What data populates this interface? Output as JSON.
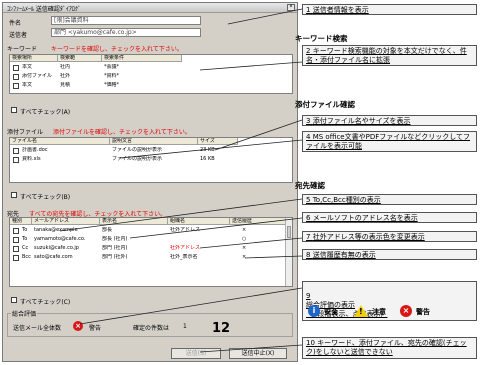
{
  "dialog": {
    "title": "ｺﾝﾌｧｰﾑﾒｰﾙ 送信確認ﾀﾞｲｱﾛｸﾞ",
    "close_label": "×",
    "sender_name_label": "件名",
    "sender_name_value": "[限]会議資料",
    "sender_addr_label": "送信者",
    "sender_addr_value": "部門 <yakumo@cafe.co.jp>",
    "keyword_label": "キーワード",
    "keyword_hint": "キーワードを確認し、チェックを入れて下さい。",
    "keyword_columns": [
      "検索場所",
      "検索範",
      "検索条件"
    ],
    "keyword_rows": [
      {
        "place": "本文",
        "range": "社内",
        "cond": "*会議*"
      },
      {
        "place": "添付ファイル",
        "range": "社外",
        "cond": "*資料*"
      },
      {
        "place": "本文",
        "range": "見積",
        "cond": "*価格*"
      }
    ],
    "keyword_checkall": "すべてチェック(A)",
    "attach_label": "添付ファイル",
    "attach_hint": "添付ファイルを確認し、チェックを入れて下さい。",
    "attach_columns": [
      "ファイル名",
      "説明文言",
      "サイズ"
    ],
    "attach_rows": [
      {
        "name": "計画書.doc",
        "desc": "ファイルの説明が表示",
        "size": "23 KB"
      },
      {
        "name": "資料.xls",
        "desc": "ファイルの説明が表示",
        "size": "16 KB"
      }
    ],
    "attach_checkall": "すべてチェック(B)",
    "dest_label": "宛先",
    "dest_hint": "すべての宛先を確認し、チェックを入れて下さい。",
    "dest_columns": [
      "種別",
      "メールアドレス",
      "表示名",
      "組織名",
      "送信履歴"
    ],
    "dest_rows": [
      {
        "type": "To",
        "addr": "tanaka@example",
        "name": "部長",
        "org": "社外アドレス",
        "hist": "×"
      },
      {
        "type": "To",
        "addr": "yamamoto@cafe.co.",
        "name": "部長 (社内)",
        "org": "",
        "hist": "○"
      },
      {
        "type": "Cc",
        "addr": "suzuki@cafe.co.jp",
        "name": "部門 (社内)",
        "org": "社外アドレス",
        "hist": "×"
      },
      {
        "type": "Bcc",
        "addr": "sato@cafe.com",
        "name": "部門 (社外)",
        "org": "社外_表示名",
        "hist": "×"
      }
    ],
    "dest_checkall": "すべてチェック(C)",
    "eval_label": "総合評価",
    "eval_text": "送信メール全体数",
    "eval_icon_mark": "×",
    "eval_status": "警告",
    "eval_confirm_text": "確定の件数は",
    "eval_confirm_value": "1",
    "send_button": "送信(S)",
    "cancel_button": "送信中止(X)",
    "big_number": "12"
  },
  "callouts": [
    {
      "num": "1",
      "text": "送信者情報を表示"
    },
    {
      "num": "2",
      "text": "キーワード検索機能の対象を本文だけでなく、件名・添付ファイル名に拡張"
    },
    {
      "num": "3",
      "text": "添付ファイル名やサイズを表示"
    },
    {
      "num": "4",
      "text": "MS office文書やPDFファイルなどクリックしてファイルを表示可能"
    },
    {
      "num": "5",
      "text": "To,Cc,Bcc種別の表示"
    },
    {
      "num": "6",
      "text": "メールソフトのアドレス名を表示"
    },
    {
      "num": "7",
      "text": "社外アドレス等の表示色を変更表示"
    },
    {
      "num": "8",
      "text": "送信履歴有無の表示"
    },
    {
      "num": "9",
      "text": "総合評価の表示\n（3段階表示、点数表示）"
    },
    {
      "num": "10",
      "text": "キーワード、添付ファイル、宛先の確認(チェック)をしないと送信できない"
    }
  ],
  "sections": {
    "keyword": "キーワード検索",
    "attach": "添付ファイル確認",
    "dest": "宛先確認"
  },
  "legend": {
    "safe": "安全",
    "caution": "注意",
    "warning": "警告",
    "safe_icon": "info-icon",
    "caution_icon": "warning-triangle-icon",
    "warning_icon": "error-circle-icon"
  },
  "colors": {
    "hint_red": "#e00000",
    "info_blue": "#1e66c8",
    "caution_yellow": "#f0d000",
    "error_red": "#d81818"
  }
}
